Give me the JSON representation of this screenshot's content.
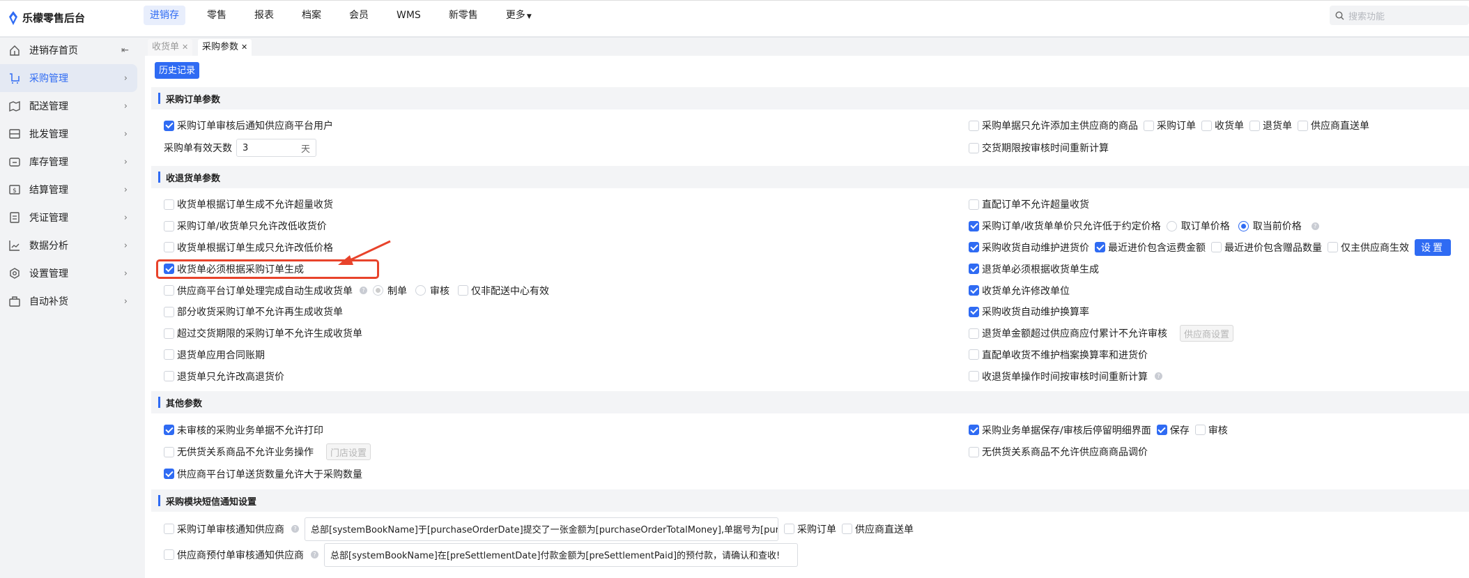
{
  "app": {
    "title": "乐檬零售后台"
  },
  "nav": [
    {
      "label": "进销存",
      "active": true
    },
    {
      "label": "零售"
    },
    {
      "label": "报表"
    },
    {
      "label": "档案"
    },
    {
      "label": "会员"
    },
    {
      "label": "WMS"
    },
    {
      "label": "新零售"
    },
    {
      "label": "更多",
      "dropdown": true
    }
  ],
  "search": {
    "placeholder": "搜索功能"
  },
  "sidebar": [
    {
      "label": "进销存首页",
      "icon": "home-icon"
    },
    {
      "label": "采购管理",
      "icon": "cart-icon",
      "active": true
    },
    {
      "label": "配送管理",
      "icon": "map-icon"
    },
    {
      "label": "批发管理",
      "icon": "server-icon"
    },
    {
      "label": "库存管理",
      "icon": "inventory-icon"
    },
    {
      "label": "结算管理",
      "icon": "dollar-icon"
    },
    {
      "label": "凭证管理",
      "icon": "document-icon"
    },
    {
      "label": "数据分析",
      "icon": "chart-icon"
    },
    {
      "label": "设置管理",
      "icon": "settings-icon"
    },
    {
      "label": "自动补货",
      "icon": "basket-icon"
    }
  ],
  "tabs": [
    {
      "label": "收货单",
      "active": false
    },
    {
      "label": "采购参数",
      "active": true
    }
  ],
  "history_button": "历史记录",
  "colors": {
    "accent": "#2f6bf3",
    "annotation": "#e8432b"
  },
  "sections": [
    {
      "title": "采购订单参数",
      "left": [
        [
          {
            "type": "checkbox",
            "label": "采购订单审核后通知供应商平台用户",
            "checked": true
          }
        ],
        [
          {
            "type": "label",
            "label": "采购单有效天数"
          },
          {
            "type": "number",
            "value": "3",
            "suffix": "天"
          }
        ]
      ],
      "right": [
        [
          {
            "type": "checkbox",
            "label": "采购单据只允许添加主供应商的商品",
            "checked": false
          },
          {
            "type": "checkbox",
            "label": "采购订单",
            "checked": false
          },
          {
            "type": "checkbox",
            "label": "收货单",
            "checked": false
          },
          {
            "type": "checkbox",
            "label": "退货单",
            "checked": false
          },
          {
            "type": "checkbox",
            "label": "供应商直送单",
            "checked": false
          }
        ],
        [
          {
            "type": "checkbox",
            "label": "交货期限按审核时间重新计算",
            "checked": false
          }
        ]
      ]
    },
    {
      "title": "收退货单参数",
      "left": [
        [
          {
            "type": "checkbox",
            "label": "收货单根据订单生成不允许超量收货",
            "checked": false
          }
        ],
        [
          {
            "type": "checkbox",
            "label": "采购订单/收货单只允许改低收货价",
            "checked": false
          }
        ],
        [
          {
            "type": "checkbox",
            "label": "收货单根据订单生成只允许改低价格",
            "checked": false
          }
        ],
        [
          {
            "type": "checkbox",
            "label": "收货单必须根据采购订单生成",
            "checked": true
          }
        ],
        [
          {
            "type": "checkbox",
            "label": "供应商平台订单处理完成自动生成收货单",
            "checked": false
          },
          {
            "type": "help"
          },
          {
            "type": "radio",
            "label": "制单",
            "checked": false,
            "disabled": true
          },
          {
            "type": "radio",
            "label": "审核",
            "checked": false
          },
          {
            "type": "checkbox",
            "label": "仅非配送中心有效",
            "checked": false
          }
        ],
        [
          {
            "type": "checkbox",
            "label": "部分收货采购订单不允许再生成收货单",
            "checked": false
          }
        ],
        [
          {
            "type": "checkbox",
            "label": "超过交货期限的采购订单不允许生成收货单",
            "checked": false
          }
        ],
        [
          {
            "type": "checkbox",
            "label": "退货单应用合同账期",
            "checked": false
          }
        ],
        [
          {
            "type": "checkbox",
            "label": "退货单只允许改高退货价",
            "checked": false
          }
        ]
      ],
      "right": [
        [
          {
            "type": "checkbox",
            "label": "直配订单不允许超量收货",
            "checked": false
          }
        ],
        [
          {
            "type": "checkbox",
            "label": "采购订单/收货单单价只允许低于约定价格",
            "checked": true
          },
          {
            "type": "radio",
            "label": "取订单价格",
            "checked": false
          },
          {
            "type": "radio",
            "label": "取当前价格",
            "checked": true
          },
          {
            "type": "help"
          }
        ],
        [
          {
            "type": "checkbox",
            "label": "采购收货自动维护进货价",
            "checked": true
          },
          {
            "type": "checkbox",
            "label": "最近进价包含运费金额",
            "checked": true
          },
          {
            "type": "checkbox",
            "label": "最近进价包含赠品数量",
            "checked": false
          },
          {
            "type": "checkbox",
            "label": "仅主供应商生效",
            "checked": false
          },
          {
            "type": "button",
            "label": "设置",
            "variant": "primary"
          }
        ],
        [
          {
            "type": "checkbox",
            "label": "退货单必须根据收货单生成",
            "checked": true
          }
        ],
        [
          {
            "type": "checkbox",
            "label": "收货单允许修改单位",
            "checked": true
          }
        ],
        [
          {
            "type": "checkbox",
            "label": "采购收货自动维护换算率",
            "checked": true
          }
        ],
        [
          {
            "type": "checkbox",
            "label": "退货单金额超过供应商应付累计不允许审核",
            "checked": false
          },
          {
            "type": "button",
            "label": "供应商设置",
            "variant": "disabled"
          }
        ],
        [
          {
            "type": "checkbox",
            "label": "直配单收货不维护档案换算率和进货价",
            "checked": false
          }
        ],
        [
          {
            "type": "checkbox",
            "label": "收退货单操作时间按审核时间重新计算",
            "checked": false
          },
          {
            "type": "help"
          }
        ]
      ]
    },
    {
      "title": "其他参数",
      "left": [
        [
          {
            "type": "checkbox",
            "label": "未审核的采购业务单据不允许打印",
            "checked": true
          }
        ],
        [
          {
            "type": "checkbox",
            "label": "无供货关系商品不允许业务操作",
            "checked": false
          },
          {
            "type": "button",
            "label": "门店设置",
            "variant": "disabled"
          }
        ],
        [
          {
            "type": "checkbox",
            "label": "供应商平台订单送货数量允许大于采购数量",
            "checked": true
          }
        ]
      ],
      "right": [
        [
          {
            "type": "checkbox",
            "label": "采购业务单据保存/审核后停留明细界面",
            "checked": true
          },
          {
            "type": "checkbox",
            "label": "保存",
            "checked": true
          },
          {
            "type": "checkbox",
            "label": "审核",
            "checked": false
          }
        ],
        [
          {
            "type": "checkbox",
            "label": "无供货关系商品不允许供应商商品调价",
            "checked": false
          }
        ]
      ]
    },
    {
      "title": "采购模块短信通知设置",
      "left": [
        [
          {
            "type": "checkbox",
            "label": "采购订单审核通知供应商",
            "checked": false
          },
          {
            "type": "help"
          },
          {
            "type": "text",
            "value": "总部[systemBookName]于[purchaseOrderDate]提交了一张金额为[purchaseOrderTotalMoney],单据号为[purc"
          },
          {
            "type": "checkbox",
            "label": "采购订单",
            "checked": false
          },
          {
            "type": "checkbox",
            "label": "供应商直送单",
            "checked": false
          }
        ],
        [
          {
            "type": "checkbox",
            "label": "供应商预付单审核通知供应商",
            "checked": false
          },
          {
            "type": "help"
          },
          {
            "type": "text",
            "value": "总部[systemBookName]在[preSettlementDate]付款金额为[preSettlementPaid]的预付款，请确认和查收!"
          }
        ]
      ],
      "right": []
    }
  ]
}
